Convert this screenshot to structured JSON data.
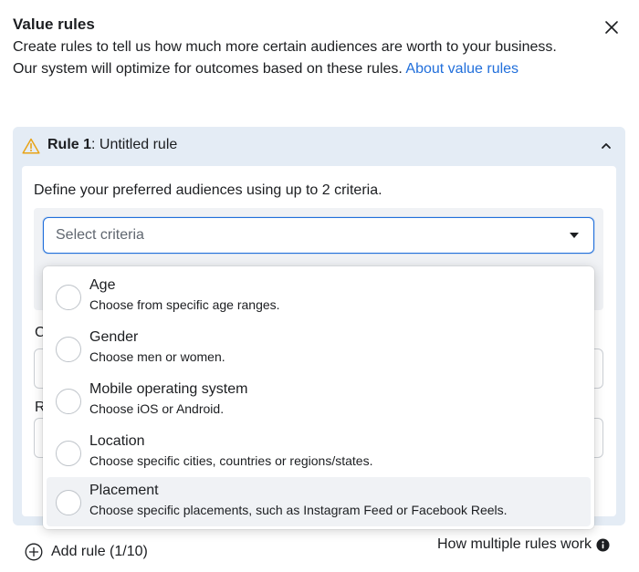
{
  "header": {
    "title": "Value rules",
    "description": "Create rules to tell us how much more certain audiences are worth to your business. Our system will optimize for outcomes based on these rules.",
    "link_text": "About value rules",
    "close_icon": "close-icon"
  },
  "rule": {
    "number_label": "Rule 1",
    "name": ": Untitled rule",
    "warning_icon": "warning-icon",
    "collapse_icon": "chevron-up-icon",
    "define_text": "Define your preferred audiences using up to 2 criteria.",
    "select_placeholder": "Select criteria",
    "hidden_label_1": "C",
    "hidden_label_2": "R"
  },
  "criteria_options": [
    {
      "title": "Age",
      "description": "Choose from specific age ranges."
    },
    {
      "title": "Gender",
      "description": "Choose men or women."
    },
    {
      "title": "Mobile operating system",
      "description": "Choose iOS or Android."
    },
    {
      "title": "Location",
      "description": "Choose specific cities, countries or regions/states."
    },
    {
      "title": "Placement",
      "description": "Choose specific placements, such as Instagram Feed or Facebook Reels."
    }
  ],
  "footer": {
    "add_rule": "Add rule (1/10)",
    "how_rules": "How multiple rules work"
  },
  "colors": {
    "accent": "#216fdb",
    "card_bg": "#e4ecf5",
    "warning": "#f7b928"
  }
}
